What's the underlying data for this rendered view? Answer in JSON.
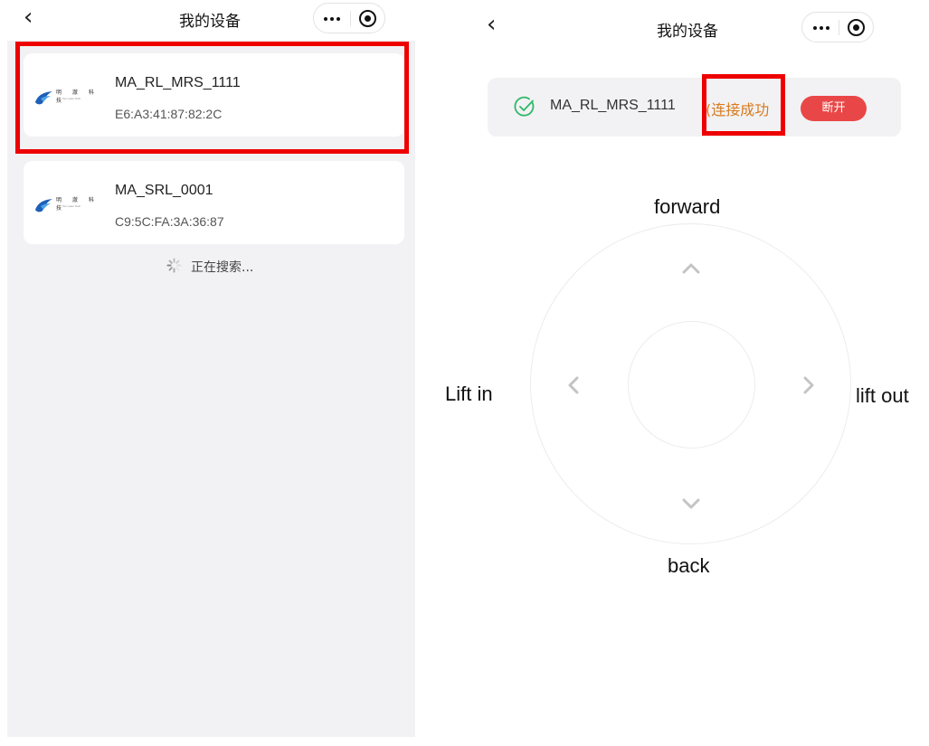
{
  "left": {
    "nav": {
      "back": "‹",
      "title": "我的设备"
    },
    "devices": [
      {
        "name": "MA_RL_MRS_1111",
        "mac": "E6:A3:41:87:82:2C",
        "logo_cn": "明 澈 科 技",
        "logo_en": "Tec Laser Tech"
      },
      {
        "name": "MA_SRL_0001",
        "mac": "C9:5C:FA:3A:36:87",
        "logo_cn": "明 澈 科 技",
        "logo_en": "Tec Laser Tech"
      }
    ],
    "searching_text": "正在搜索..."
  },
  "right": {
    "nav": {
      "back": "‹",
      "title": "我的设备"
    },
    "connection": {
      "device_name": "MA_RL_MRS_1111",
      "status": "(连接成功",
      "disconnect_label": "断开"
    },
    "joystick": {
      "forward": "forward",
      "back": "back",
      "left": "Lift in",
      "right": "lift out"
    }
  },
  "colors": {
    "highlight": "#ee0000",
    "status_orange": "#d87a1e",
    "disconnect_red": "#e94747",
    "check_green": "#2fb86a"
  },
  "icons": [
    "back-arrow-icon",
    "more-dots-icon",
    "target-icon",
    "logo-icon",
    "spinner-icon",
    "check-circle-icon",
    "chevron-up-icon",
    "chevron-down-icon",
    "chevron-left-icon",
    "chevron-right-icon"
  ]
}
